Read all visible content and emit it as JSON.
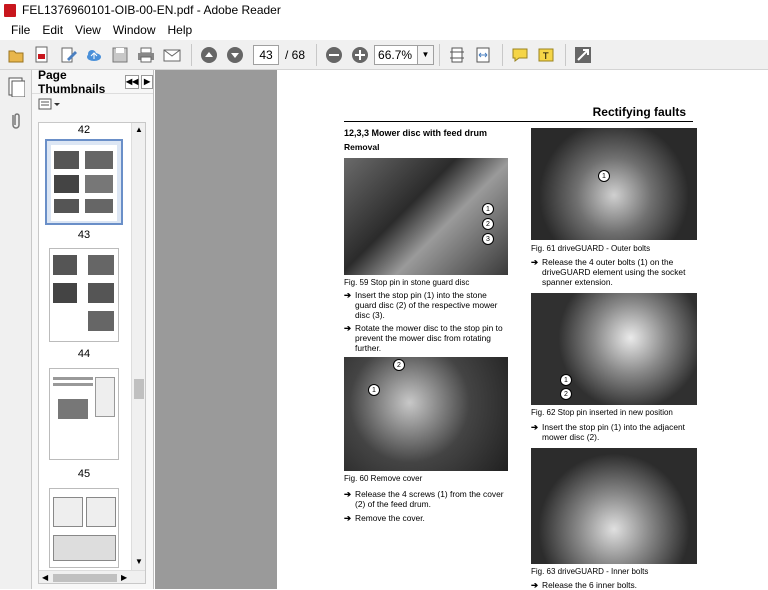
{
  "window": {
    "title": "FEL1376960101-OIB-00-EN.pdf - Adobe Reader"
  },
  "menu": [
    "File",
    "Edit",
    "View",
    "Window",
    "Help"
  ],
  "toolbar": {
    "page_current": "43",
    "page_total": "/ 68",
    "zoom": "66.7%"
  },
  "panel": {
    "title": "Page Thumbnails",
    "prev_btn": "◀◀",
    "next_btn": "▶"
  },
  "thumbnails": [
    {
      "label": "42",
      "selected": true
    },
    {
      "label": "43",
      "selected": false
    },
    {
      "label": "44",
      "selected": false
    },
    {
      "label": "45",
      "selected": false
    }
  ],
  "doc": {
    "header": "Rectifying faults",
    "section": "12,3,3 Mower disc with feed drum",
    "subsection": "Removal",
    "fig59": "Fig. 59     Stop pin in stone guard disc",
    "step1": "Insert the stop pin (1) into the stone guard disc (2) of the respective mower disc (3).",
    "step2": "Rotate the mower disc to the stop pin to prevent the mower disc from rotating further.",
    "fig60": "Fig. 60     Remove cover",
    "step3": "Release the 4 screws (1) from the cover (2) of the feed drum.",
    "step4": "Remove the cover.",
    "fig61": "Fig. 61     driveGUARD - Outer bolts",
    "step5": "Release the 4 outer bolts (1) on the driveGUARD element using the socket spanner extension.",
    "fig62": "Fig. 62     Stop pin inserted in new position",
    "step6": "Insert the stop pin (1) into the adjacent mower disc (2).",
    "fig63": "Fig. 63     driveGUARD - Inner bolts",
    "step7": "Release the 6 inner bolts."
  }
}
